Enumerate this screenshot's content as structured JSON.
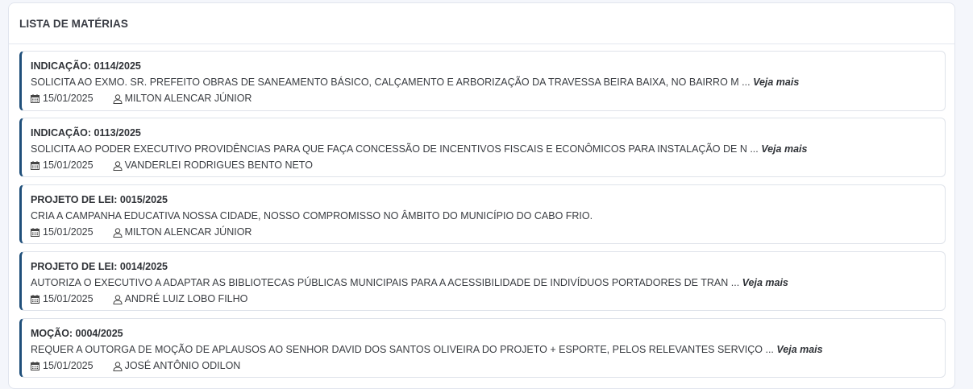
{
  "panel": {
    "title": "LISTA DE MATÉRIAS"
  },
  "items": [
    {
      "title": "INDICAÇÃO: 0114/2025",
      "description": "SOLICITA AO EXMO. SR. PREFEITO OBRAS DE SANEAMENTO BÁSICO, CALÇAMENTO E ARBORIZAÇÃO DA TRAVESSA BEIRA BAIXA, NO BAIRRO M ...",
      "more_label": "Veja mais",
      "date": "15/01/2025",
      "author": "MILTON ALENCAR JÚNIOR"
    },
    {
      "title": "INDICAÇÃO: 0113/2025",
      "description": "SOLICITA AO PODER EXECUTIVO PROVIDÊNCIAS PARA QUE FAÇA CONCESSÃO DE INCENTIVOS FISCAIS E ECONÔMICOS PARA INSTALAÇÃO DE N ...",
      "more_label": "Veja mais",
      "date": "15/01/2025",
      "author": "VANDERLEI RODRIGUES BENTO NETO"
    },
    {
      "title": "PROJETO DE LEI: 0015/2025",
      "description": "CRIA A CAMPANHA EDUCATIVA NOSSA CIDADE, NOSSO COMPROMISSO NO ÂMBITO DO MUNICÍPIO DO CABO FRIO.",
      "more_label": "",
      "date": "15/01/2025",
      "author": "MILTON ALENCAR JÚNIOR"
    },
    {
      "title": "PROJETO DE LEI: 0014/2025",
      "description": "AUTORIZA O EXECUTIVO A ADAPTAR AS BIBLIOTECAS PÚBLICAS MUNICIPAIS PARA A ACESSIBILIDADE DE INDIVÍDUOS PORTADORES DE TRAN ...",
      "more_label": "Veja mais",
      "date": "15/01/2025",
      "author": "ANDRÉ LUIZ LOBO FILHO"
    },
    {
      "title": "MOÇÃO: 0004/2025",
      "description": "REQUER A OUTORGA DE MOÇÃO DE APLAUSOS AO SENHOR DAVID DOS SANTOS OLIVEIRA DO PROJETO + ESPORTE, PELOS RELEVANTES SERVIÇO ...",
      "more_label": "Veja mais",
      "date": "15/01/2025",
      "author": "JOSÉ ANTÔNIO ODILON"
    }
  ],
  "icons": {
    "date": "calendar-icon",
    "author": "user-icon"
  },
  "colors": {
    "accent_border": "#1f4f7a",
    "background": "#f4f6fb"
  }
}
